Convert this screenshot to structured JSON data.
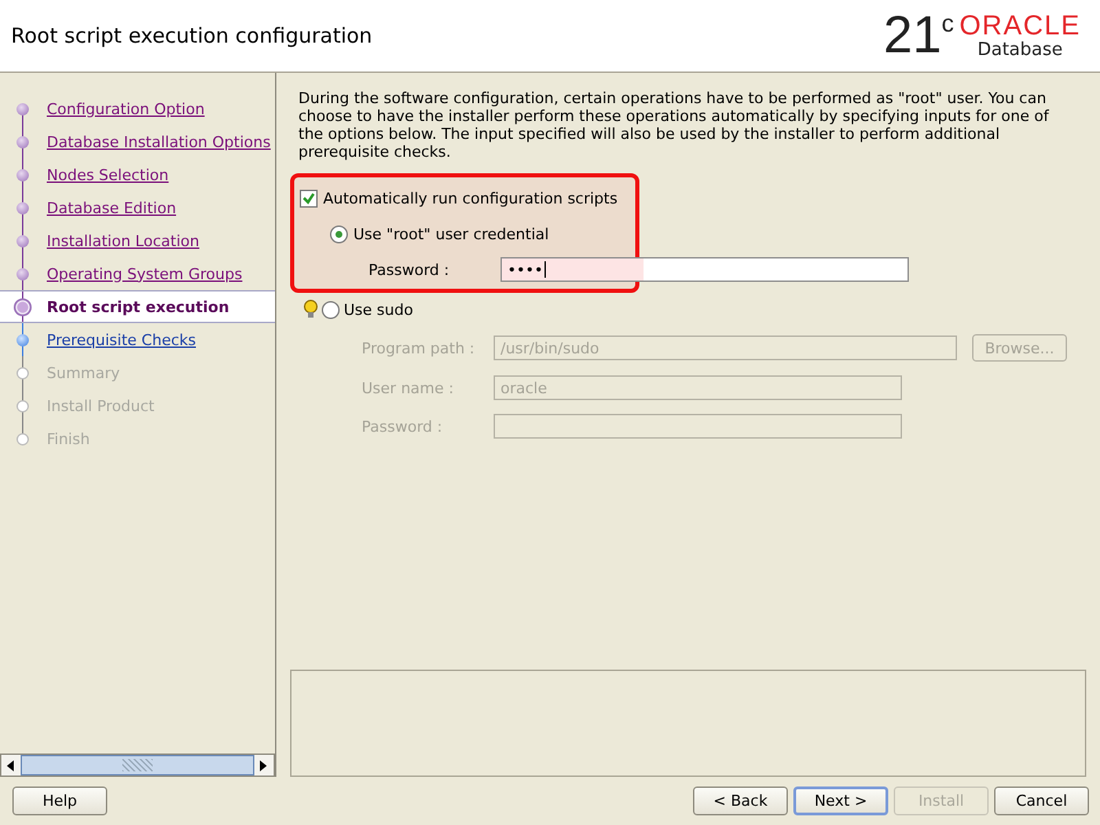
{
  "header": {
    "title": "Root script execution configuration",
    "logo": {
      "version": "21",
      "superscript": "c",
      "brand": "ORACLE",
      "product": "Database"
    }
  },
  "steps": [
    {
      "label": "Configuration Option",
      "kind": "visited",
      "selected": false
    },
    {
      "label": "Database Installation Options",
      "kind": "visited",
      "selected": false
    },
    {
      "label": "Nodes Selection",
      "kind": "visited",
      "selected": false
    },
    {
      "label": "Database Edition",
      "kind": "visited",
      "selected": false
    },
    {
      "label": "Installation Location",
      "kind": "visited",
      "selected": false
    },
    {
      "label": "Operating System Groups",
      "kind": "visited",
      "selected": false
    },
    {
      "label": "Root script execution",
      "kind": "current",
      "selected": true
    },
    {
      "label": "Prerequisite Checks",
      "kind": "next",
      "selected": false
    },
    {
      "label": "Summary",
      "kind": "pending",
      "selected": false
    },
    {
      "label": "Install Product",
      "kind": "pending",
      "selected": false
    },
    {
      "label": "Finish",
      "kind": "pending",
      "selected": false
    }
  ],
  "description": "During the software configuration, certain operations have to be performed as \"root\" user. You can choose to have the installer perform these operations automatically by specifying inputs for one of the options below. The input specified will also be used by the installer to perform additional prerequisite checks.",
  "auto_run": {
    "label": "Automatically run configuration scripts",
    "checked": true
  },
  "root_option": {
    "label": "Use \"root\" user credential",
    "selected": true,
    "password_label": "Password :",
    "password": "••••"
  },
  "sudo_option": {
    "label": "Use sudo",
    "selected": false,
    "program_path_label": "Program path :",
    "program_path": "/usr/bin/sudo",
    "browse": "Browse...",
    "user_name_label": "User name :",
    "user_name": "oracle",
    "password_label": "Password :"
  },
  "buttons": [
    {
      "label": "Help",
      "disabled": false,
      "default": false
    },
    {
      "label": "< Back",
      "disabled": false,
      "default": false
    },
    {
      "label": "Next >",
      "disabled": false,
      "default": true
    },
    {
      "label": "Install",
      "disabled": true,
      "default": false
    },
    {
      "label": "Cancel",
      "disabled": false,
      "default": false
    }
  ]
}
